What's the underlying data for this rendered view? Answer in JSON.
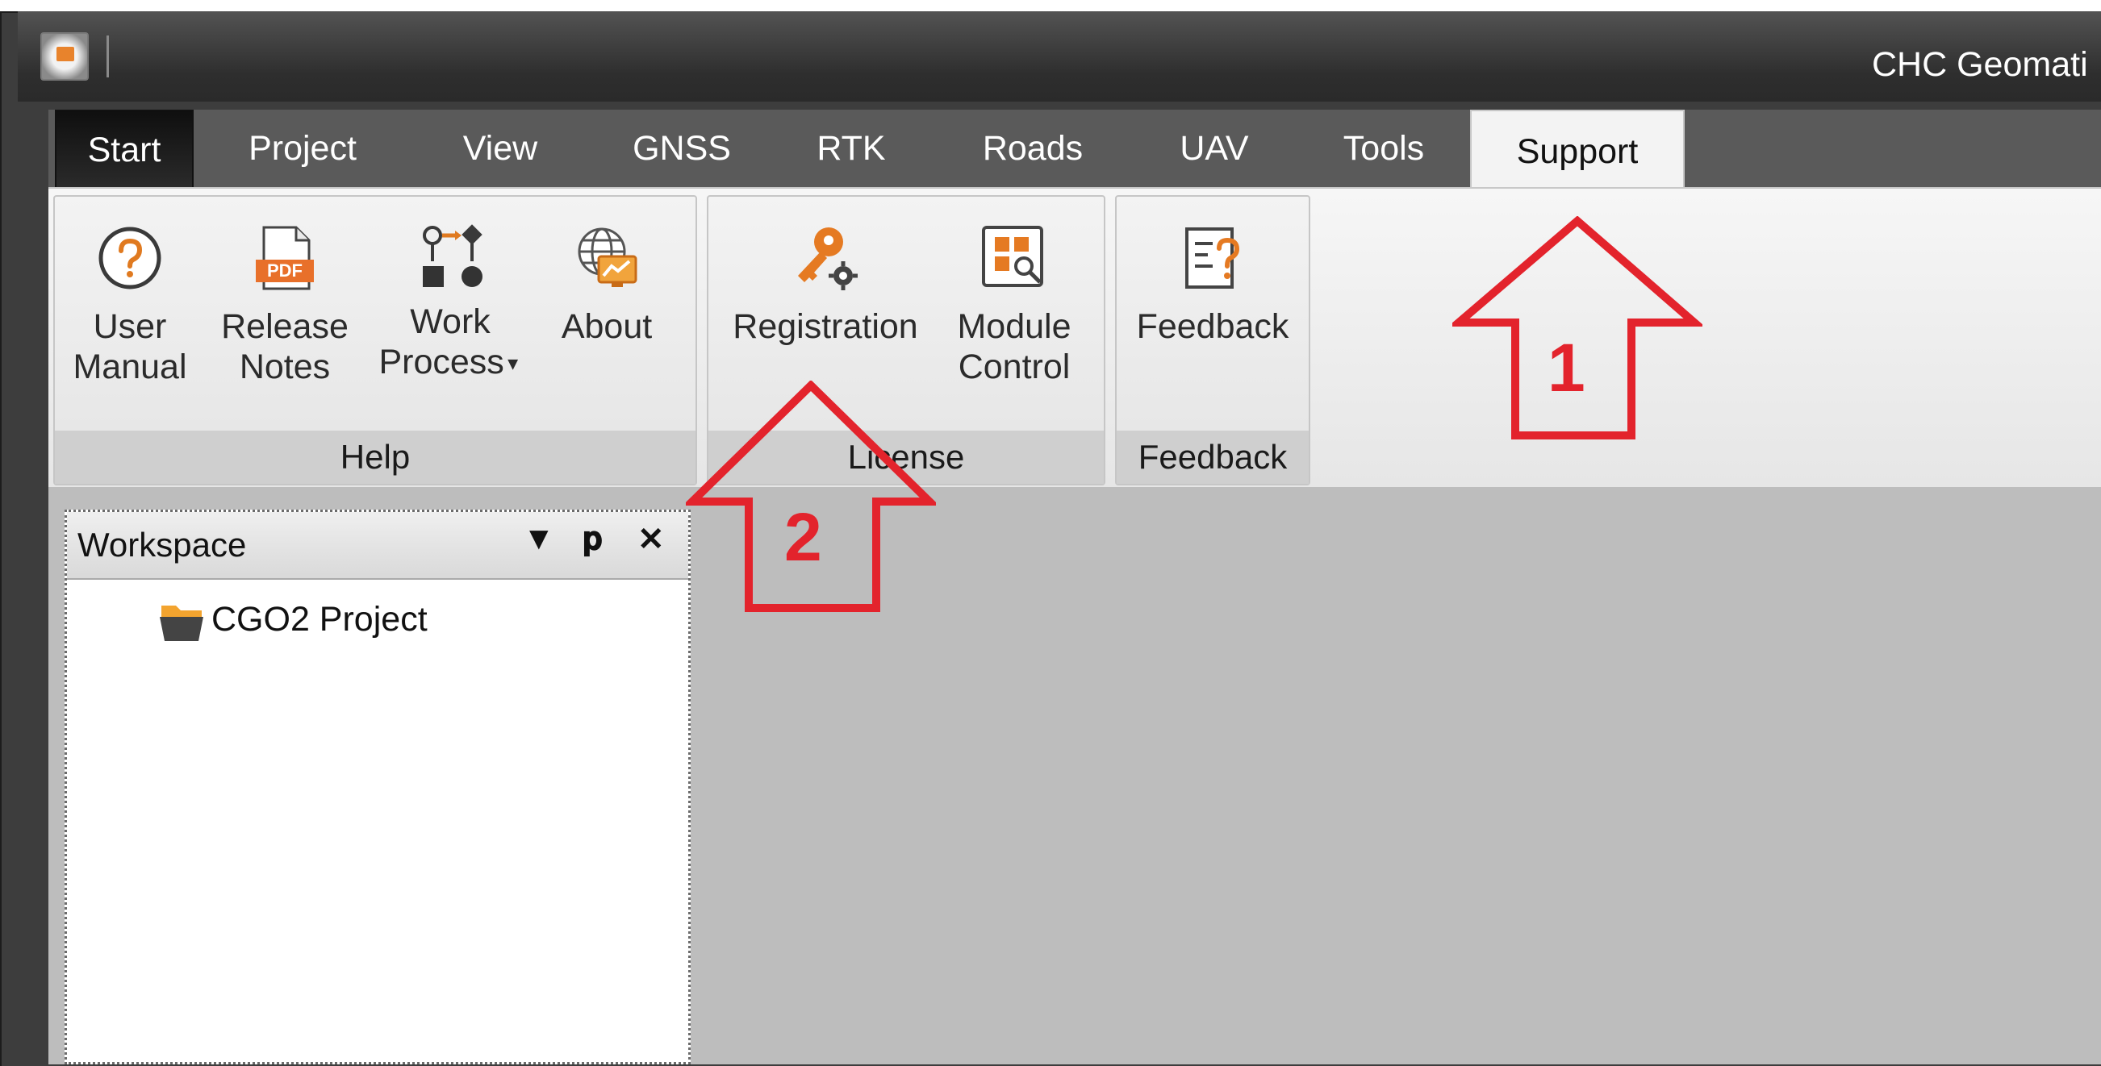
{
  "window": {
    "title": "CHC Geomati"
  },
  "tabs": [
    {
      "label": "Start"
    },
    {
      "label": "Project"
    },
    {
      "label": "View"
    },
    {
      "label": "GNSS"
    },
    {
      "label": "RTK"
    },
    {
      "label": "Roads"
    },
    {
      "label": "UAV"
    },
    {
      "label": "Tools"
    },
    {
      "label": "Support"
    }
  ],
  "selected_tab": "Support",
  "ribbon": {
    "help": {
      "label": "Help",
      "buttons": [
        {
          "line1": "User",
          "line2": "Manual",
          "icon": "question-icon"
        },
        {
          "line1": "Release",
          "line2": "Notes",
          "icon": "pdf-icon"
        },
        {
          "line1": "Work",
          "line2": "Process",
          "icon": "workflow-icon"
        },
        {
          "line1": "About",
          "line2": "",
          "icon": "globe-monitor-icon"
        }
      ]
    },
    "license": {
      "label": "License",
      "buttons": [
        {
          "line1": "Registration",
          "line2": "",
          "icon": "key-icon"
        },
        {
          "line1": "Module",
          "line2": "Control",
          "icon": "module-control-icon"
        }
      ]
    },
    "feedback": {
      "label": "Feedback",
      "buttons": [
        {
          "line1": "Feedback",
          "line2": "",
          "icon": "feedback-icon"
        }
      ]
    }
  },
  "workspace": {
    "title": "Workspace",
    "tree": [
      {
        "label": "CGO2 Project",
        "icon": "folder-icon"
      }
    ]
  },
  "annotations": [
    {
      "number": "1"
    },
    {
      "number": "2"
    }
  ],
  "colors": {
    "annotation": "#e3232c",
    "pdf": "#e8702a",
    "key": "#e57a22"
  }
}
